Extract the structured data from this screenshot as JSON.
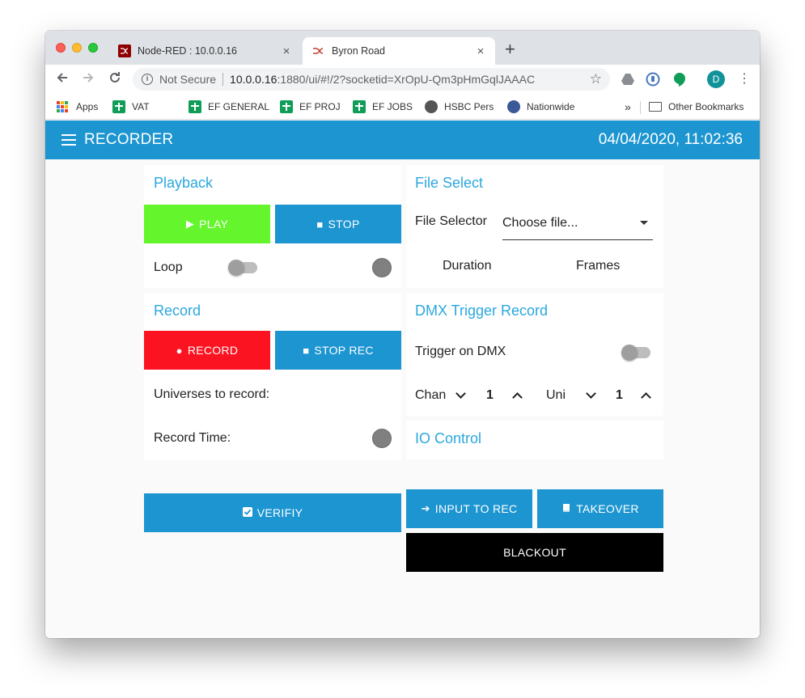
{
  "browser": {
    "tabs": [
      {
        "title": "Node-RED : 10.0.0.16",
        "active": false
      },
      {
        "title": "Byron Road",
        "active": true
      }
    ],
    "new_tab": "+",
    "close_glyph": "×",
    "address": {
      "security": "Not Secure",
      "host": "10.0.0.16",
      "path": ":1880/ui/#!/2?socketid=XrOpU-Qm3pHmGqlJAAAC"
    },
    "profile_initial": "D",
    "bookmarks": [
      {
        "label": "Apps",
        "icon": "apps-grid-icon"
      },
      {
        "label": "VAT",
        "icon": "sheets-icon"
      },
      {
        "label": "EF GENERAL",
        "icon": "sheets-icon"
      },
      {
        "label": "EF PROJ",
        "icon": "sheets-icon"
      },
      {
        "label": "EF JOBS",
        "icon": "sheets-icon"
      },
      {
        "label": "HSBC Pers",
        "icon": "globe-icon"
      },
      {
        "label": "Nationwide",
        "icon": "globe-icon"
      }
    ],
    "bookmarks_overflow": "»",
    "other_bookmarks": "Other Bookmarks"
  },
  "dashboard": {
    "title": "RECORDER",
    "datetime": "04/04/2020, 11:02:36",
    "header_color": "#1c95d1",
    "playback": {
      "title": "Playback",
      "play_label": "PLAY",
      "stop_label": "STOP",
      "loop_label": "Loop"
    },
    "record": {
      "title": "Record",
      "record_label": "RECORD",
      "stop_rec_label": "STOP REC",
      "universes_label": "Universes to record:",
      "record_time_label": "Record Time:",
      "verify_label": "VERIFIY"
    },
    "file_select": {
      "title": "File Select",
      "selector_label": "File Selector",
      "selector_value": "Choose file...",
      "duration_label": "Duration",
      "frames_label": "Frames"
    },
    "dmx_trigger": {
      "title": "DMX Trigger Record",
      "trigger_label": "Trigger on DMX",
      "chan_label": "Chan",
      "chan_value": "1",
      "uni_label": "Uni",
      "uni_value": "1"
    },
    "io_control": {
      "title": "IO Control",
      "input_label": "INPUT TO REC",
      "takeover_label": "TAKEOVER",
      "blackout_label": "BLACKOUT"
    },
    "colors": {
      "play": "#64f52c",
      "blue": "#1c95d1",
      "record": "#fc1321",
      "blackout": "#000000"
    }
  }
}
